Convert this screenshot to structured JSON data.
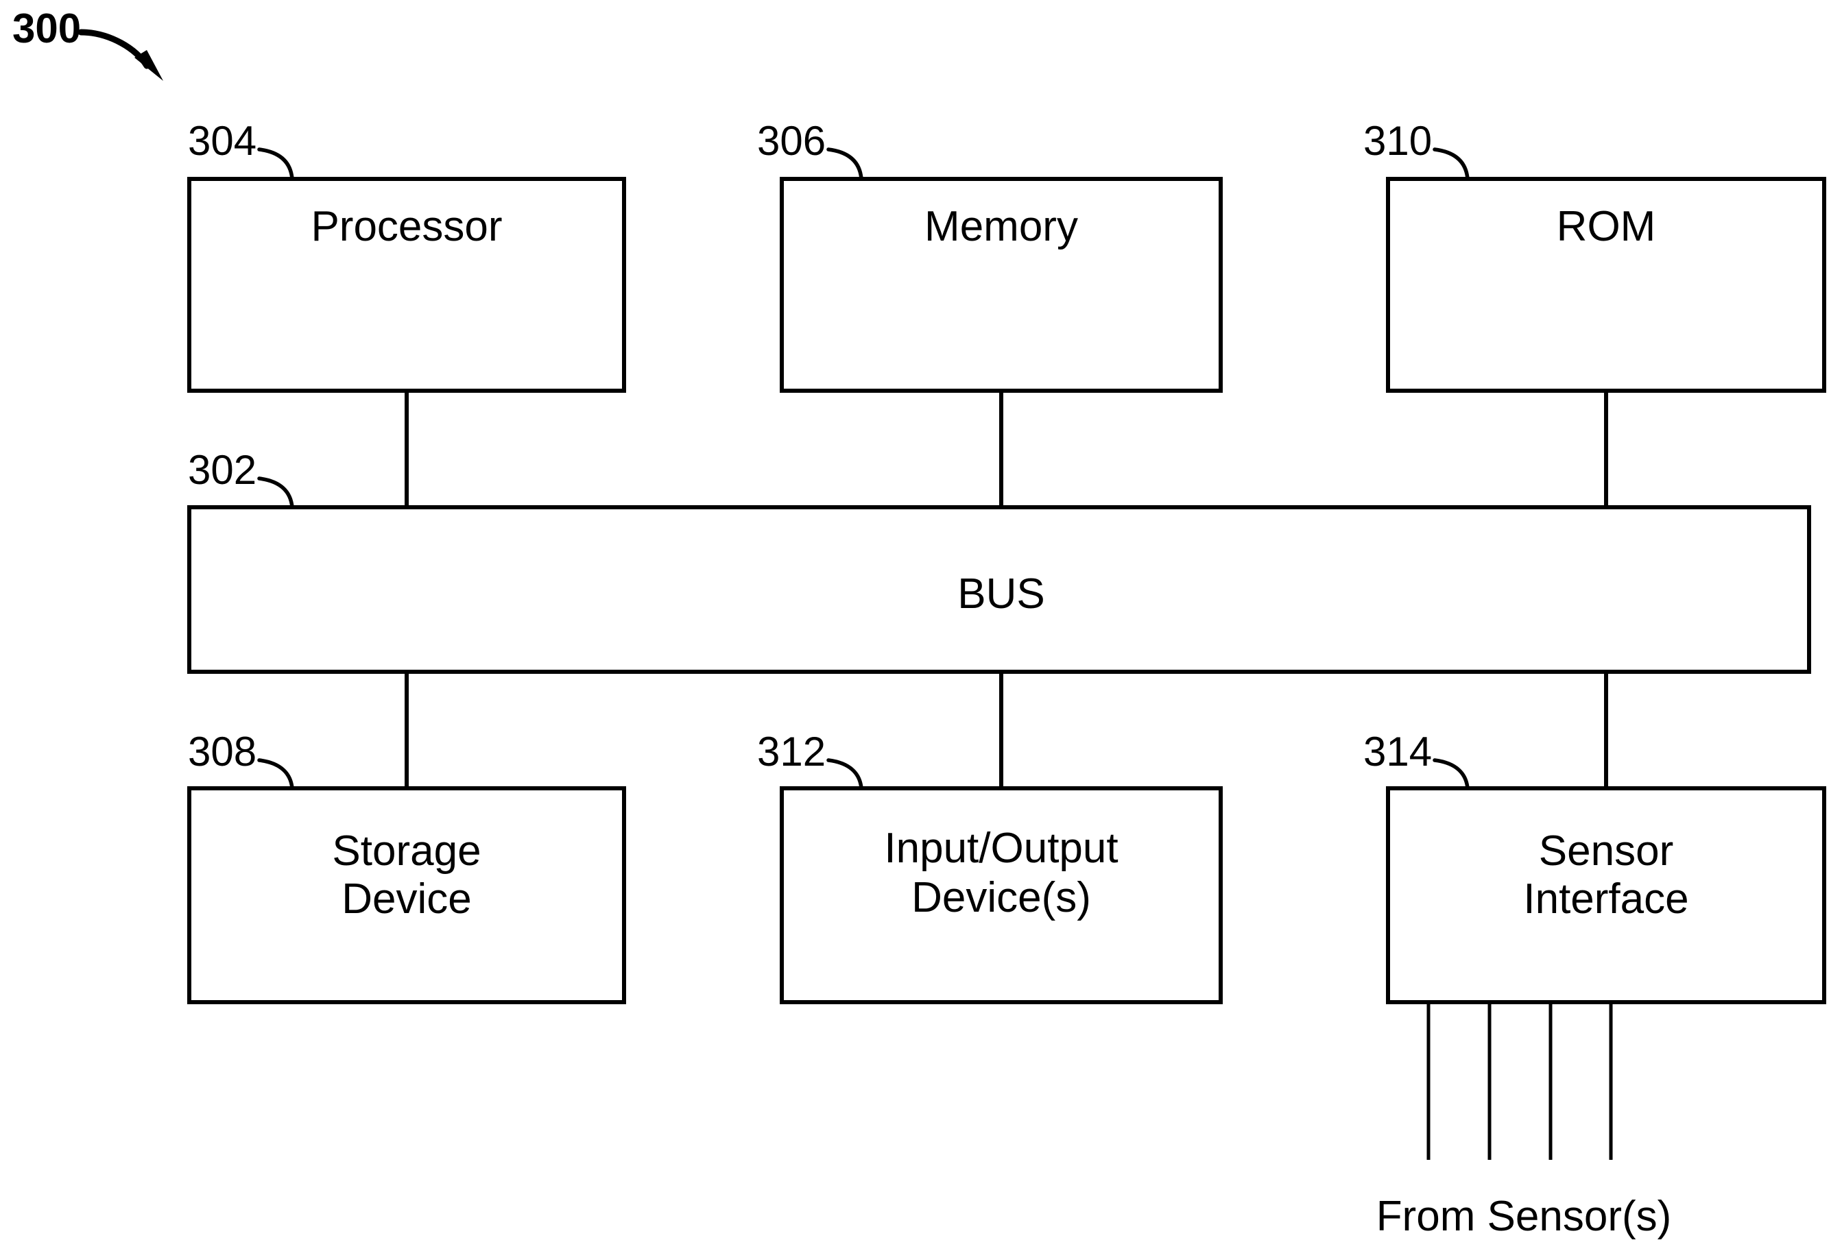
{
  "figure": {
    "number": "300",
    "caption_below_sensors": "From Sensor(s)"
  },
  "blocks": [
    {
      "id": "processor",
      "ref": "304",
      "lines": [
        "Processor"
      ],
      "row": "top"
    },
    {
      "id": "memory",
      "ref": "306",
      "lines": [
        "Memory"
      ],
      "row": "top"
    },
    {
      "id": "rom",
      "ref": "310",
      "lines": [
        "ROM"
      ],
      "row": "top"
    },
    {
      "id": "bus",
      "ref": "302",
      "lines": [
        "BUS"
      ],
      "row": "middle"
    },
    {
      "id": "storage-device",
      "ref": "308",
      "lines": [
        "Storage",
        "Device"
      ],
      "row": "bottom"
    },
    {
      "id": "input-output-devices",
      "ref": "312",
      "lines": [
        "Input/Output",
        "Device(s)"
      ],
      "row": "bottom"
    },
    {
      "id": "sensor-interface",
      "ref": "314",
      "lines": [
        "Sensor",
        "Interface"
      ],
      "row": "bottom"
    }
  ],
  "labels": {
    "processor": "Processor",
    "memory": "Memory",
    "rom": "ROM",
    "bus": "BUS",
    "storage_line1": "Storage",
    "storage_line2": "Device",
    "io_line1": "Input/Output",
    "io_line2": "Device(s)",
    "sensor_line1": "Sensor",
    "sensor_line2": "Interface",
    "from_sensors": "From Sensor(s)"
  },
  "refs": {
    "figure": "300",
    "bus": "302",
    "processor": "304",
    "memory": "306",
    "storage": "308",
    "rom": "310",
    "io": "312",
    "sensor_interface": "314"
  },
  "style": {
    "stroke_color": "#000000",
    "fill_color": "#ffffff",
    "background": "#ffffff"
  },
  "sensor_inputs": {
    "count": 4
  }
}
